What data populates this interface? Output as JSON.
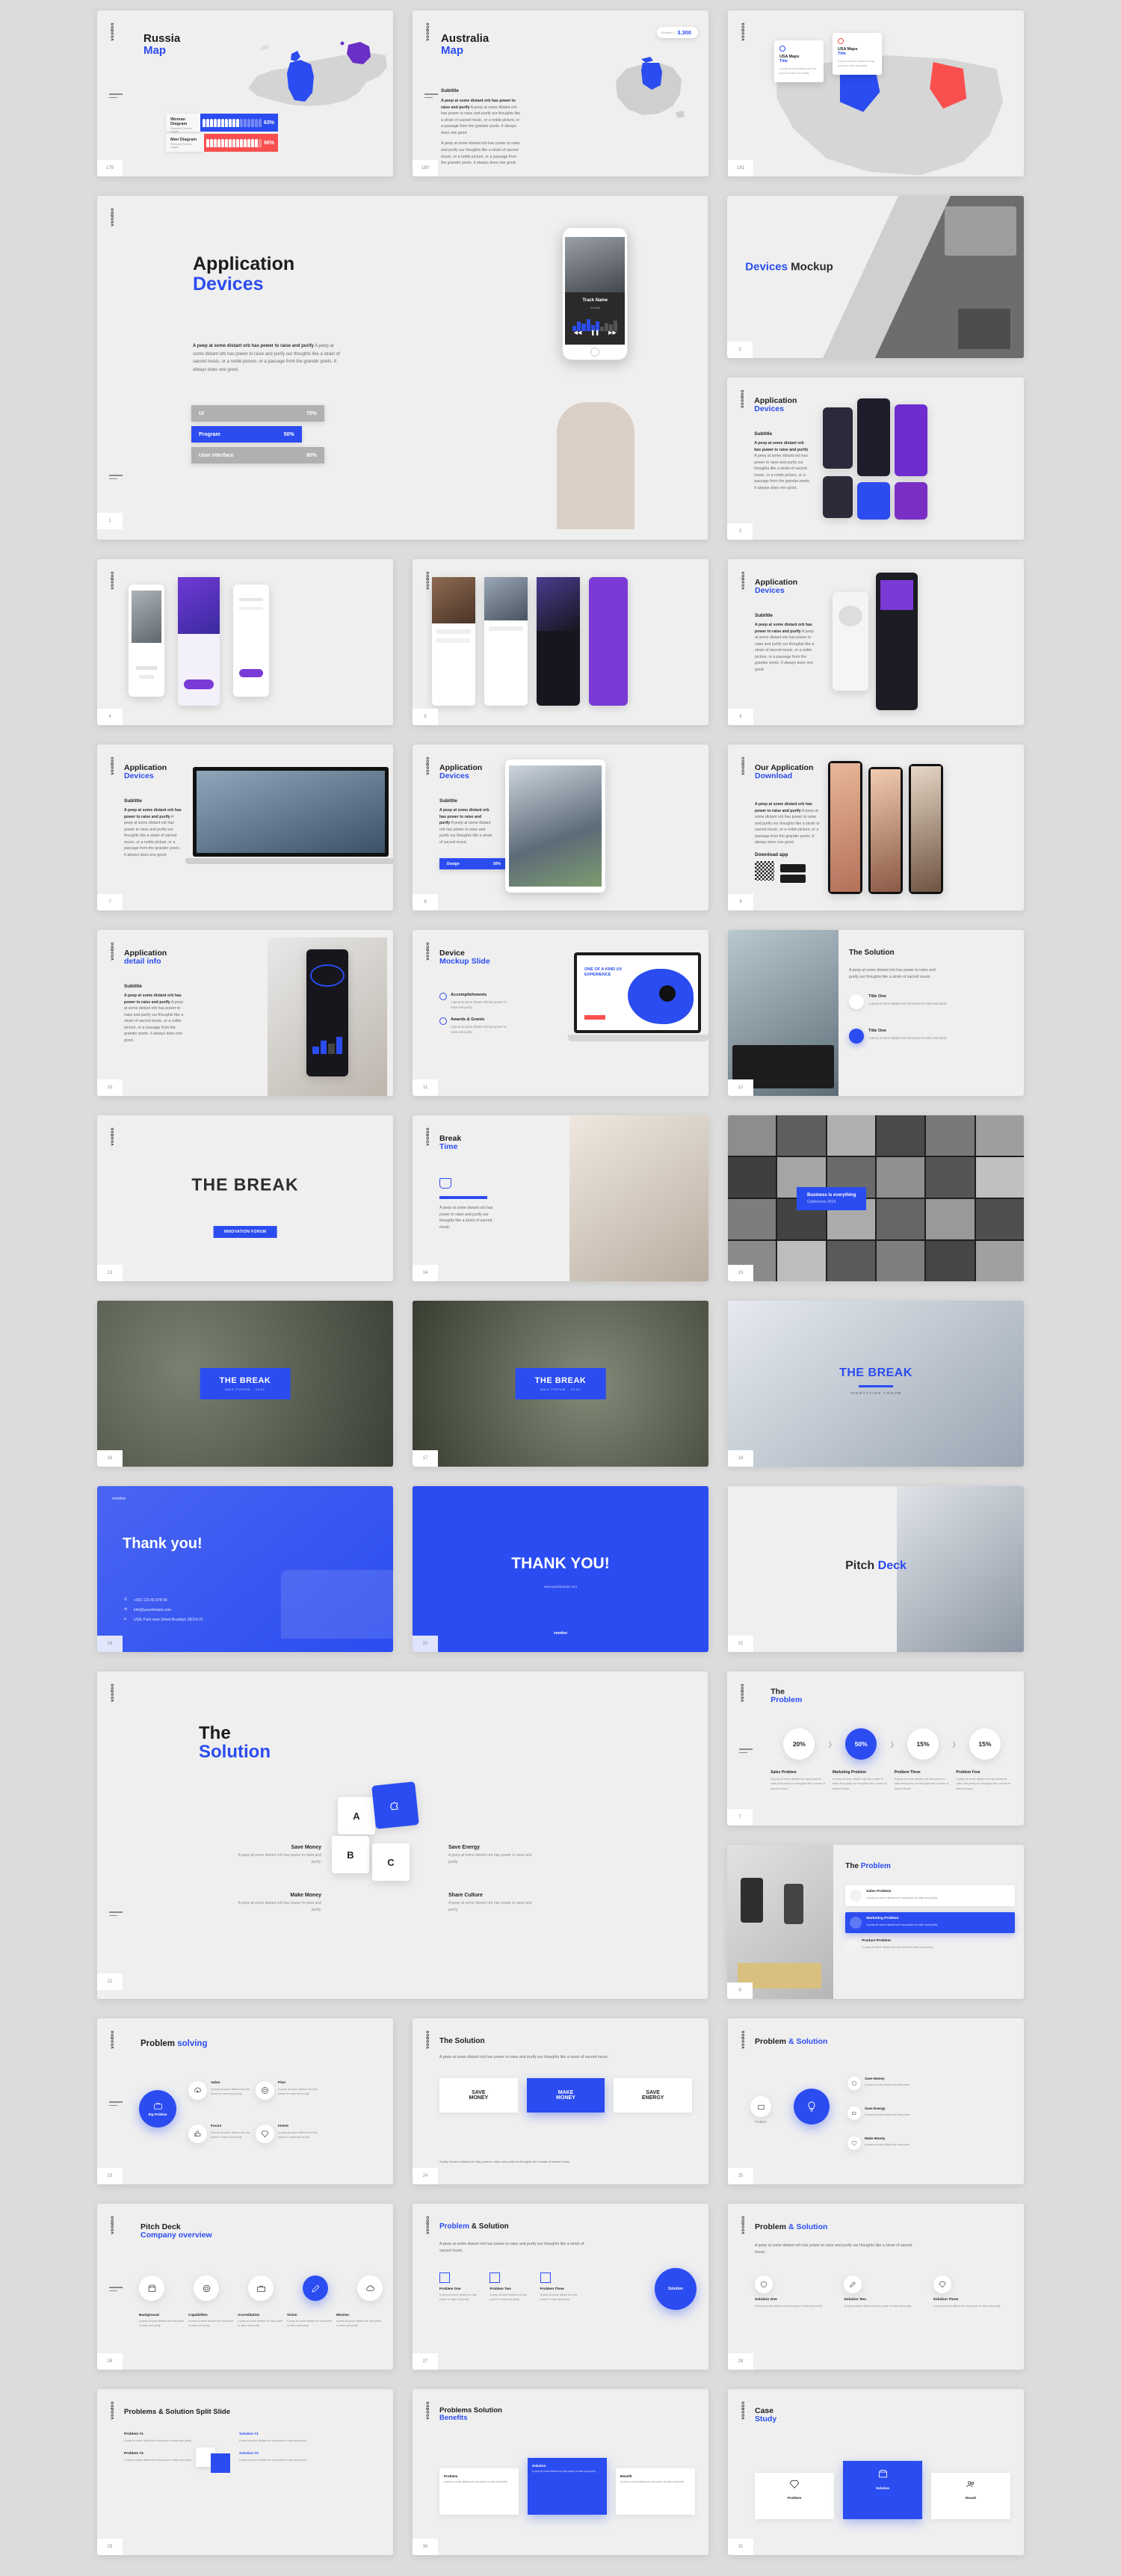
{
  "brand": "voodoo",
  "accent": "#2b4cf0",
  "red": "#f9504f",
  "purple": "#6a2fc4",
  "lorem": {
    "bold_lead": "A peep at some distant orb has power to raise and purify",
    "full": "A peep at some distant orb has power to raise and purify our thoughts like a strain of sacred music, or a noble picture, or a passage from the grander poets. It always does one good.",
    "second": "A peep at some distant orb has power to raise and purify our thoughts like a strain of sacred music, or a noble picture, or a passage from the grander poets. It always does one good.",
    "short": "A peep at some distant orb has power to raise and purify our thoughts like a strain of sacred music.",
    "tiny": "A peep at some distant orb has power to raise and purify.",
    "subtitle": "Subtitle"
  },
  "slides": {
    "russia_map": {
      "title_top": "Russia",
      "title_bottom": "Map",
      "page": "179",
      "legend": [
        {
          "name": "Woman Diagram",
          "slogan": "Featured Service slogan",
          "pct": "63%",
          "value": 63,
          "color": "#2b4cf0",
          "filled": 10,
          "total": 16
        },
        {
          "name": "Man Diagram",
          "slogan": "Featured Service slogan",
          "pct": "96%",
          "value": 96,
          "color": "#f9504f",
          "filled": 14,
          "total": 15
        }
      ]
    },
    "australia_map": {
      "title_top": "Australia",
      "title_bottom": "Map",
      "subtitle": "Subtitle",
      "badge_value": "3.300",
      "badge_label": "Number 1",
      "page": "180"
    },
    "usa_map": {
      "cards": [
        {
          "title": "USA Maps",
          "sub": "Title"
        },
        {
          "title": "USA Maps",
          "sub": "Title"
        }
      ],
      "page": "181"
    },
    "application_devices_main": {
      "title_top": "Application",
      "title_bottom": "Devices",
      "bars": [
        {
          "label": "UI",
          "pct": "75%",
          "value": 75,
          "style": "grey"
        },
        {
          "label": "Program",
          "pct": "50%",
          "value": 50,
          "style": "blue"
        },
        {
          "label": "User interface",
          "pct": "90%",
          "value": 90,
          "style": "grey"
        }
      ],
      "phone": {
        "track": "Track Name",
        "artist": "Subtitle"
      },
      "page": "1"
    },
    "devices_mockup": {
      "title_a": "Devices",
      "title_b": "Mockup",
      "page": "2"
    },
    "app_devices_2": {
      "title_top": "Application",
      "title_bottom": "Devices",
      "subtitle": "Subtitle",
      "page": "3"
    },
    "app_screens_a": {
      "page": "4"
    },
    "app_screens_b": {
      "page": "5"
    },
    "app_devices_3": {
      "title_top": "Application",
      "title_bottom": "Devices",
      "subtitle": "Subtitle",
      "page": "6"
    },
    "app_devices_laptop": {
      "title_top": "Application",
      "title_bottom": "Devices",
      "subtitle": "Subtitle",
      "page": "7"
    },
    "app_devices_tablet": {
      "title_top": "Application",
      "title_bottom": "Devices",
      "subtitle": "Subtitle",
      "bars": [
        {
          "label": "Design",
          "pct": "50%",
          "value": 50
        }
      ],
      "page": "8"
    },
    "our_app_download": {
      "title_top": "Our Application",
      "title_bottom": "Download",
      "download_label": "Download app",
      "page": "9"
    },
    "app_detail": {
      "title_top": "Application",
      "title_bottom": "detail info",
      "subtitle": "Subtitle",
      "page": "10"
    },
    "device_mockup_slide": {
      "title_top": "Device",
      "title_bottom": "Mockup Slide",
      "items": [
        {
          "label": "Accomplishments"
        },
        {
          "label": "Awards & Grants"
        }
      ],
      "badge": "ONE OF A KIND UX EXPERIENCE",
      "page": "11"
    },
    "the_solution_building": {
      "title": "The Solution",
      "items": [
        {
          "label": "Title One"
        },
        {
          "label": "Title One"
        }
      ],
      "page": "12"
    },
    "the_break_1": {
      "title": "THE BREAK",
      "button": "INNOVATION FORUM",
      "page": "13"
    },
    "break_time": {
      "title_top": "Break",
      "title_bottom": "Time",
      "page": "14"
    },
    "conference_grid": {
      "caption": "Business is everything",
      "sub": "Conference 2019",
      "page": "15"
    },
    "the_break_2": {
      "title": "THE BREAK",
      "sub": "MAG FORUM - 2019",
      "page": "16"
    },
    "the_break_3": {
      "title": "THE BREAK",
      "sub": "MAG FORUM - 2019",
      "page": "17"
    },
    "the_break_4": {
      "title": "THE BREAK",
      "sub": "INNOVATION FORUM",
      "page": "18"
    },
    "thank_you_1": {
      "title": "Thank you!",
      "contacts": [
        {
          "icon": "phone-icon",
          "text": "+001 123 45 678 99"
        },
        {
          "icon": "mail-icon",
          "text": "info@yourdomain.com"
        },
        {
          "icon": "pin-icon",
          "text": "USA, Park view Street Brooklyn 25014-21"
        }
      ],
      "page": "19"
    },
    "thank_you_2": {
      "title": "THANK YOU!",
      "sub": "www.yourdomain.com",
      "page": "20"
    },
    "pitch_deck_cover": {
      "title_a": "Pitch",
      "title_b": "Deck",
      "page": "21"
    },
    "the_solution_puzzle": {
      "title_top": "The",
      "title_bottom": "Solution",
      "pieces": [
        "A",
        "B",
        "C"
      ],
      "items": [
        {
          "label": "Save Money",
          "text": "A peep at some distant orb has power to raise and purify."
        },
        {
          "label": "Make Money",
          "text": "A peep at some distant orb has power to raise and purify."
        },
        {
          "label": "Save Energy",
          "text": "A peep at some distant orb has power to raise and purify."
        },
        {
          "label": "Share Culture",
          "text": "A peep at some distant orb has power to raise and purify."
        }
      ],
      "page": "22"
    },
    "the_problem_steps": {
      "title_top": "The",
      "title_bottom": "Problem",
      "steps": [
        {
          "pct": "20%",
          "value": 20,
          "label": "Sales Problem",
          "text": "A peep at some distant orb has power to raise and purify our thoughts like a strain of sacred music.",
          "active": false
        },
        {
          "pct": "50%",
          "value": 50,
          "label": "Marketing Problem",
          "text": "A peep at some distant orb has power to raise and purify our thoughts like a strain of sacred music.",
          "active": true
        },
        {
          "pct": "15%",
          "value": 15,
          "label": "Problem Three",
          "text": "A peep at some distant orb has power to raise and purify our thoughts like a strain of sacred music.",
          "active": false
        },
        {
          "pct": "15%",
          "value": 15,
          "label": "Problem Four",
          "text": "A peep at some distant orb has power to raise and purify our thoughts like a strain of sacred music.",
          "active": false
        }
      ],
      "page": "7"
    },
    "the_problem_photo": {
      "title_a": "The",
      "title_b": "Problem",
      "items": [
        {
          "label": "Sales Problem",
          "text": "A peep at some distant orb has power to raise and purify.",
          "active": false
        },
        {
          "label": "Marketing Problem",
          "text": "A peep at some distant orb has power to raise and purify.",
          "active": true
        },
        {
          "label": "Product Problem",
          "text": "A peep at some distant orb has power to raise and purify.",
          "active": false
        }
      ],
      "page": "8"
    },
    "problem_solving": {
      "title_a": "Problem",
      "title_b": "solving",
      "center": {
        "label": "Big Problem",
        "icon": "briefcase-icon"
      },
      "items": [
        {
          "label": "Value",
          "icon": "cloud-download-icon",
          "text": "A peep at some distant orb has power to raise and purify."
        },
        {
          "label": "Plan",
          "icon": "lifebuoy-icon",
          "text": "A peep at some distant orb has power to raise and purify."
        },
        {
          "label": "Focus",
          "icon": "thumbs-up-icon",
          "text": "A peep at some distant orb has power to raise and purify."
        },
        {
          "label": "Invest",
          "icon": "diamond-icon",
          "text": "A peep at some distant orb has power to raise and purify."
        }
      ],
      "page": "23"
    },
    "solution_cards": {
      "title": "The Solution",
      "cards": [
        {
          "l1": "SAVE",
          "l2": "MONEY",
          "active": false
        },
        {
          "l1": "MAKE",
          "l2": "MONEY",
          "active": true
        },
        {
          "l1": "SAVE",
          "l2": "ENERGY",
          "active": false
        }
      ],
      "page": "24"
    },
    "problem_and_solution_1": {
      "title_a": "Problem",
      "title_b": "& Solution",
      "center": {
        "icon": "bulb-icon"
      },
      "left_items": [
        {
          "label": "Problem"
        }
      ],
      "right_items": [
        {
          "label": "Save Money",
          "icon": "coin-icon",
          "text": "A peep at some distant orb has power."
        },
        {
          "label": "Save Energy",
          "icon": "battery-icon",
          "text": "A peep at some distant orb has power."
        },
        {
          "label": "Make Money",
          "icon": "diamond-icon",
          "text": "A peep at some distant orb has power."
        }
      ],
      "page": "25"
    },
    "pitch_deck_company": {
      "title_top": "Pitch Deck",
      "title_bottom": "Company overview",
      "items": [
        {
          "label": "Background",
          "icon": "box-icon",
          "active": false
        },
        {
          "label": "Capabilities",
          "icon": "lifebuoy-icon",
          "active": false
        },
        {
          "label": "Accreditation",
          "icon": "briefcase-icon",
          "active": false
        },
        {
          "label": "Vision",
          "icon": "pencil-icon",
          "active": true
        },
        {
          "label": "Mission",
          "icon": "cloud-download-icon",
          "active": false
        }
      ],
      "body": "A peep at some distant orb has power to raise and purify our thoughts.",
      "page": "26"
    },
    "problem_and_solution_2": {
      "title_a": "Problem",
      "title_b": "& Solution",
      "circle_label": "Solution",
      "items": [
        {
          "label": "Problem One",
          "text": "A peep at some distant orb has power to raise and purify."
        },
        {
          "label": "Problem Two",
          "text": "A peep at some distant orb has power to raise and purify."
        },
        {
          "label": "Problem Three",
          "text": "A peep at some distant orb has power to raise and purify."
        }
      ],
      "page": "27"
    },
    "problem_and_solution_3": {
      "title_a": "Problem",
      "title_b": "& Solution",
      "items": [
        {
          "label": "Solution One",
          "icon": "shield-icon"
        },
        {
          "label": "Solution Two",
          "icon": "pencil-icon"
        },
        {
          "label": "Solution Three",
          "icon": "diamond-icon"
        }
      ],
      "text": "A peep at some distant orb has power to raise and purify.",
      "page": "28"
    },
    "problems_solution_split": {
      "title": "Problems & Solution Split Slide",
      "left": [
        {
          "label": "Problem #1",
          "text": "A peep at some distant orb has power to raise and purify."
        },
        {
          "label": "Problem #2",
          "text": "A peep at some distant orb has power to raise and purify."
        }
      ],
      "right": [
        {
          "label": "Solution #1",
          "text": "A peep at some distant orb has power to raise and purify."
        },
        {
          "label": "Solution #2",
          "text": "A peep at some distant orb has power to raise and purify."
        }
      ],
      "page": "29"
    },
    "problems_solution_benefits": {
      "title_top": "Problems Solution",
      "title_bottom": "Benefits",
      "cards": [
        {
          "label": "Problem",
          "active": false
        },
        {
          "label": "Solution",
          "active": true
        },
        {
          "label": "Benefit",
          "active": false
        }
      ],
      "page": "30"
    },
    "case_study": {
      "title_top": "Case",
      "title_bottom": "Study",
      "cards": [
        {
          "label": "Problem",
          "icon": "diamond-icon",
          "active": false
        },
        {
          "label": "Solution",
          "icon": "box-icon",
          "active": true
        },
        {
          "label": "Result",
          "icon": "people-icon",
          "active": false
        }
      ],
      "page": "31"
    }
  }
}
